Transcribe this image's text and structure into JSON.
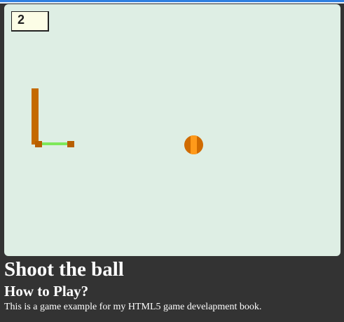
{
  "game": {
    "score": "2"
  },
  "info": {
    "title": "Shoot the ball",
    "subtitle": "How to Play?",
    "description": "This is a game example for my HTML5 game develapment book."
  },
  "colors": {
    "canvas_bg": "#deeee4",
    "page_bg": "#333333",
    "launcher": "#c46a00",
    "sling_band": "#7ee85a",
    "ball": "#d06b00",
    "ball_stripe": "#ff9a1a",
    "score_bg": "#fcfde6"
  }
}
